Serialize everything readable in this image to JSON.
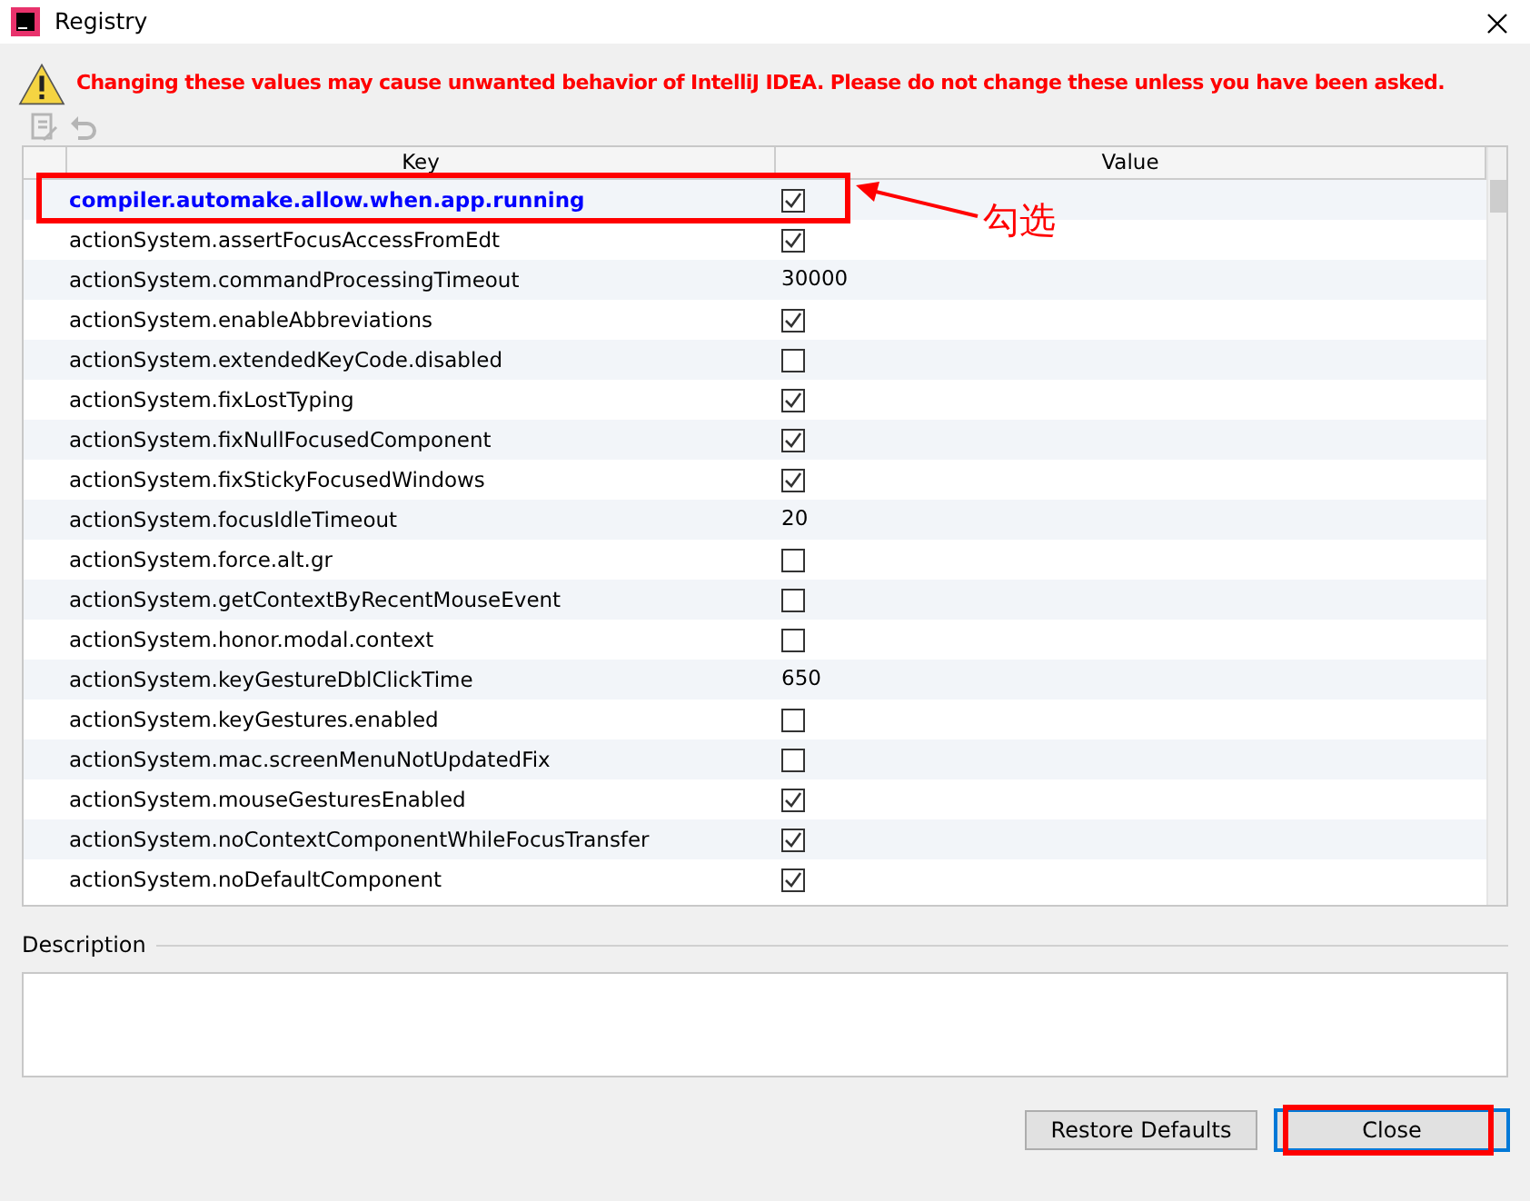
{
  "window": {
    "title": "Registry"
  },
  "warning": "Changing these values may cause unwanted behavior of IntelliJ IDEA. Please do not change these unless you have been asked.",
  "toolbar": [
    {
      "kind": "edit",
      "disabled": true
    },
    {
      "kind": "revert",
      "disabled": true
    }
  ],
  "table": {
    "columns": [
      "Key",
      "Value"
    ],
    "rows": [
      {
        "key": "compiler.automake.allow.when.app.running",
        "kind": "checkbox",
        "checked": true,
        "modified": true
      },
      {
        "key": "actionSystem.assertFocusAccessFromEdt",
        "kind": "checkbox",
        "checked": true,
        "modified": false
      },
      {
        "key": "actionSystem.commandProcessingTimeout",
        "kind": "text",
        "value": "30000",
        "modified": false
      },
      {
        "key": "actionSystem.enableAbbreviations",
        "kind": "checkbox",
        "checked": true,
        "modified": false
      },
      {
        "key": "actionSystem.extendedKeyCode.disabled",
        "kind": "checkbox",
        "checked": false,
        "modified": false
      },
      {
        "key": "actionSystem.fixLostTyping",
        "kind": "checkbox",
        "checked": true,
        "modified": false
      },
      {
        "key": "actionSystem.fixNullFocusedComponent",
        "kind": "checkbox",
        "checked": true,
        "modified": false
      },
      {
        "key": "actionSystem.fixStickyFocusedWindows",
        "kind": "checkbox",
        "checked": true,
        "modified": false
      },
      {
        "key": "actionSystem.focusIdleTimeout",
        "kind": "text",
        "value": "20",
        "modified": false
      },
      {
        "key": "actionSystem.force.alt.gr",
        "kind": "checkbox",
        "checked": false,
        "modified": false
      },
      {
        "key": "actionSystem.getContextByRecentMouseEvent",
        "kind": "checkbox",
        "checked": false,
        "modified": false
      },
      {
        "key": "actionSystem.honor.modal.context",
        "kind": "checkbox",
        "checked": false,
        "modified": false
      },
      {
        "key": "actionSystem.keyGestureDblClickTime",
        "kind": "text",
        "value": "650",
        "modified": false
      },
      {
        "key": "actionSystem.keyGestures.enabled",
        "kind": "checkbox",
        "checked": false,
        "modified": false
      },
      {
        "key": "actionSystem.mac.screenMenuNotUpdatedFix",
        "kind": "checkbox",
        "checked": false,
        "modified": false
      },
      {
        "key": "actionSystem.mouseGesturesEnabled",
        "kind": "checkbox",
        "checked": true,
        "modified": false
      },
      {
        "key": "actionSystem.noContextComponentWhileFocusTransfer",
        "kind": "checkbox",
        "checked": true,
        "modified": false
      },
      {
        "key": "actionSystem.noDefaultComponent",
        "kind": "checkbox",
        "checked": true,
        "modified": false
      }
    ]
  },
  "description": {
    "label": "Description"
  },
  "buttons": [
    {
      "label": "Restore Defaults",
      "default": false,
      "highlighted": false
    },
    {
      "label": "Close",
      "default": true,
      "highlighted": true
    }
  ],
  "annotations": [
    {
      "text": "勾选"
    }
  ]
}
